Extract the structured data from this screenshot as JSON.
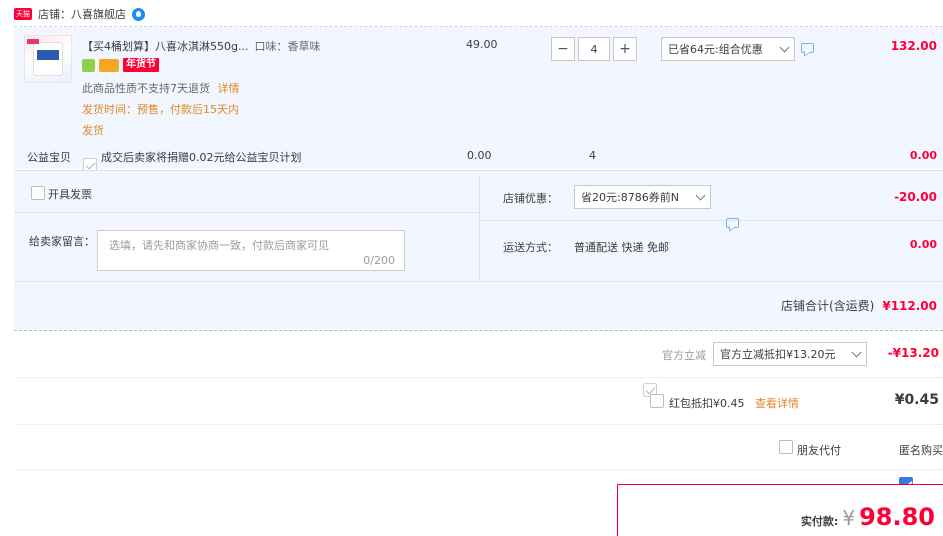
{
  "shop": {
    "badge": "天猫",
    "label": "店铺：",
    "name": "八喜旗舰店"
  },
  "item": {
    "title": "【买4桶划算】八喜冰淇淋550g...",
    "attr": "口味：香草味",
    "tag": "年货节",
    "no_return": "此商品性质不支持7天退货",
    "no_return_link": "详情",
    "ship_time": "发货时间：预售，付款后15天内",
    "ship_time_2": "发货",
    "price": "49.00",
    "qty": "4",
    "discount_select": "已省64元:组合优惠",
    "subtotal": "132.00"
  },
  "charity": {
    "label": "公益宝贝",
    "desc": "成交后卖家将捐赠0.02元给公益宝贝计划",
    "price": "0.00",
    "qty": "4",
    "amount": "0.00"
  },
  "invoice": {
    "label": "开具发票"
  },
  "shop_discount": {
    "label": "店铺优惠：",
    "select": "省20元:8786券前N",
    "amount": "-20.00"
  },
  "message": {
    "label": "给卖家留言：",
    "placeholder": "选填，请先和商家协商一致，付款后商家可见",
    "counter": "0/200"
  },
  "shipping": {
    "label": "运送方式：",
    "method": "普通配送 快递 免邮",
    "amount": "0.00"
  },
  "shop_total": {
    "label": "店铺合计(含运费)",
    "amount": "¥112.00"
  },
  "official": {
    "label": "官方立减",
    "select": "官方立减抵扣¥13.20元",
    "amount": "-¥13.20"
  },
  "redpacket": {
    "label": "红包抵扣¥0.45",
    "link": "查看详情",
    "amount": "¥0.45"
  },
  "options": {
    "friend_pay": "朋友代付",
    "anonymous": "匿名购买"
  },
  "pay": {
    "label": "实付款:",
    "currency": "¥",
    "amount": "98.80"
  },
  "colors": {
    "accent_red": "#ff0036",
    "panel_bg": "#f2f7ff",
    "link_orange": "#e0882a"
  }
}
